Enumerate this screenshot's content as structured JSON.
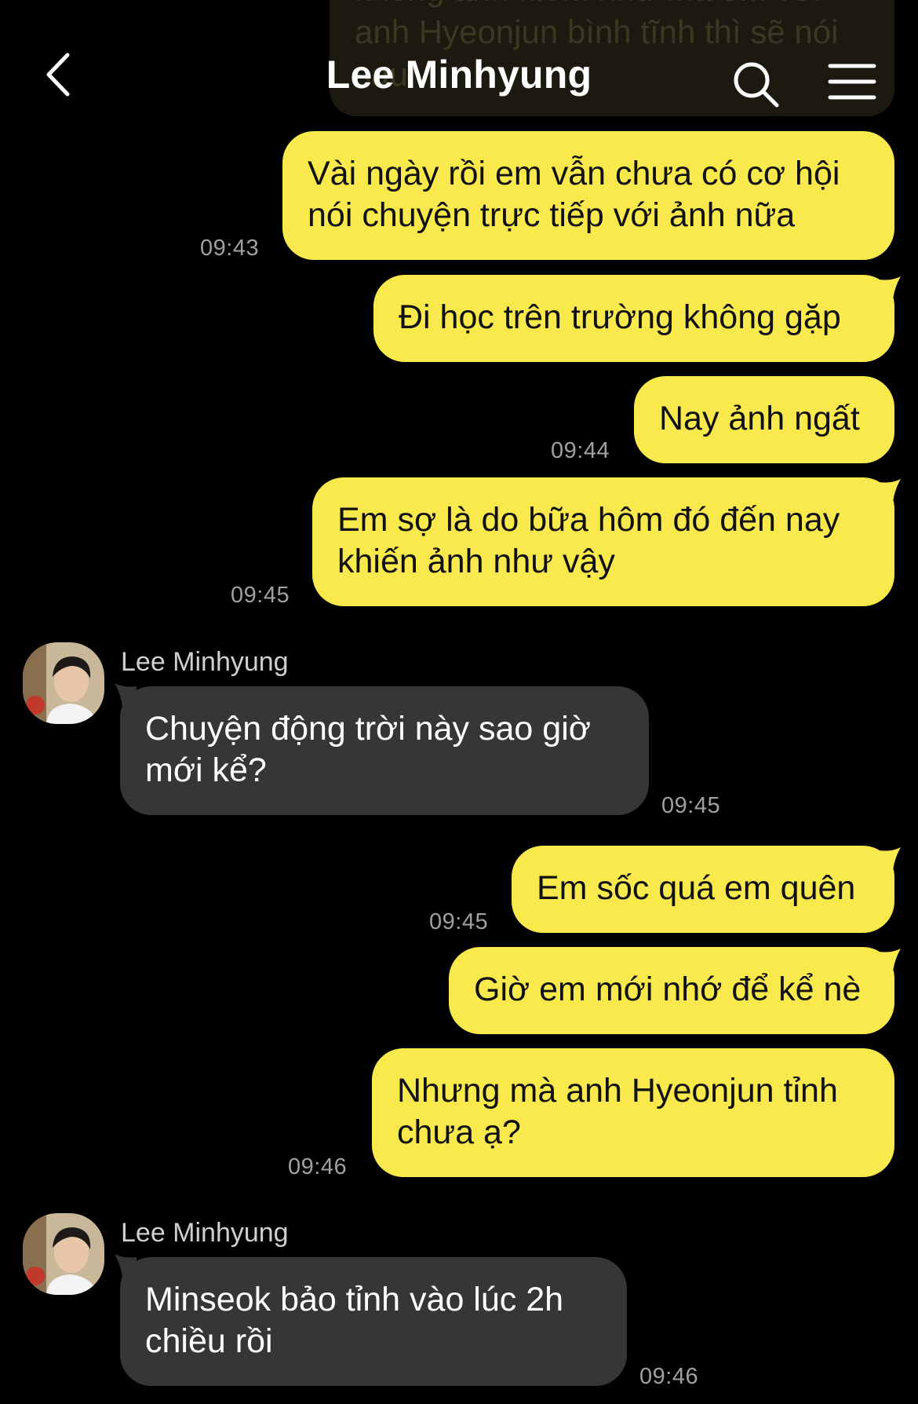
{
  "header": {
    "title": "Lee Minhyung",
    "back_icon": "chevron-left-icon",
    "search_icon": "search-icon",
    "menu_icon": "menu-icon"
  },
  "previous_message_partial": "không ảnh hiểm như mà em với anh Hyeonjun bình tĩnh thì sẽ nói sau",
  "messages": [
    {
      "side": "mine",
      "lines": [
        "Vài ngày rồi em vẫn chưa có cơ hội",
        "nói chuyện trực tiếp với ảnh nữa"
      ],
      "time": "09:43"
    },
    {
      "side": "mine",
      "lines": [
        "Đi học trên trường không gặp"
      ],
      "time": ""
    },
    {
      "side": "mine",
      "lines": [
        "Nay ảnh ngất"
      ],
      "time": "09:44"
    },
    {
      "side": "mine",
      "lines": [
        "Em sợ là do bữa hôm đó đến nay",
        "khiến ảnh như vậy"
      ],
      "time": "09:45"
    },
    {
      "side": "theirs",
      "sender": "Lee Minhyung",
      "lines": [
        "Chuyện động trời này sao giờ",
        "mới kể?"
      ],
      "time": "09:45"
    },
    {
      "side": "mine",
      "lines": [
        "Em sốc quá em quên"
      ],
      "time": "09:45"
    },
    {
      "side": "mine",
      "lines": [
        "Giờ em mới nhớ để kể nè"
      ],
      "time": ""
    },
    {
      "side": "mine",
      "lines": [
        "Nhưng mà anh Hyeonjun tỉnh",
        "chưa ạ?"
      ],
      "time": "09:46"
    },
    {
      "side": "theirs",
      "sender": "Lee Minhyung",
      "lines": [
        "Minseok bảo tỉnh vào lúc 2h",
        "chiều rồi"
      ],
      "time": "09:46"
    }
  ],
  "colors": {
    "background": "#000000",
    "mine_bubble": "#fae94c",
    "theirs_bubble": "#363636",
    "timestamp": "#a0a0a0"
  }
}
